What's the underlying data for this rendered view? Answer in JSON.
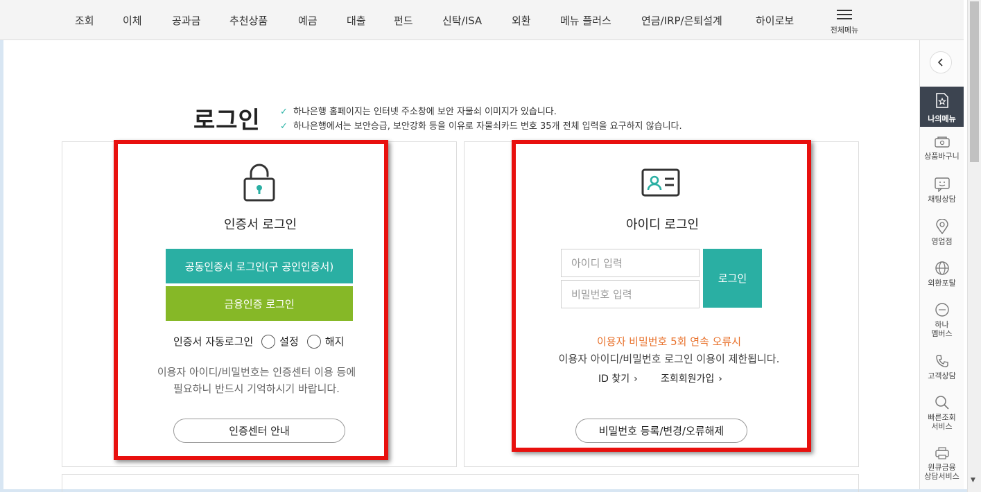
{
  "nav": {
    "items": [
      "조회",
      "이체",
      "공과금",
      "추천상품",
      "예금",
      "대출",
      "펀드",
      "신탁/ISA",
      "외환",
      "메뉴 플러스",
      "연금/IRP/은퇴설계",
      "하이로보"
    ],
    "all_menu_label": "전체메뉴",
    "all_menu_icon": "hamburger-icon"
  },
  "title": "로그인",
  "notices": [
    "하나은행 홈페이지는 인터넷 주소창에 보안 자물쇠 이미지가 있습니다.",
    "하나은행에서는 보안승급, 보안강화 등을 이유로 자물쇠카드 번호 35개 전체 입력을 요구하지 않습니다."
  ],
  "cert_login": {
    "icon": "lock-icon",
    "heading": "인증서 로그인",
    "joint_cert_button": "공동인증서 로그인(구 공인인증서)",
    "financial_cert_button": "금융인증 로그인",
    "auto_login_label": "인증서 자동로그인",
    "option_set": "설정",
    "option_unset": "해지",
    "note_line1": "이용자 아이디/비밀번호는 인증센터 이용 등에",
    "note_line2": "필요하니 반드시 기억하시기 바랍니다.",
    "cert_center_button": "인증센터 안내"
  },
  "id_login": {
    "icon": "id-card-icon",
    "heading": "아이디 로그인",
    "id_placeholder": "아이디 입력",
    "pw_placeholder": "비밀번호 입력",
    "login_button": "로그인",
    "warning_orange": "이용자 비밀번호 5회 연속 오류시",
    "warning_gray": "이용자 아이디/비밀번호 로그인 이용이 제한됩니다.",
    "find_id": "ID 찾기",
    "join": "조회회원가입",
    "pw_button": "비밀번호 등록/변경/오류해제"
  },
  "quickbar": {
    "my_menu": "나의메뉴",
    "items": [
      {
        "label": "상품바구니",
        "icon": "basket-icon"
      },
      {
        "label": "채팅상담",
        "icon": "chat-icon"
      },
      {
        "label": "영업점",
        "icon": "location-pin-icon"
      },
      {
        "label": "외환포탈",
        "icon": "globe-icon"
      },
      {
        "label": "하나",
        "label2": "멤버스",
        "icon": "hana-members-icon"
      },
      {
        "label": "고객상담",
        "icon": "phone-icon"
      },
      {
        "label": "빠른조회",
        "label2": "서비스",
        "icon": "search-icon"
      },
      {
        "label": "원큐금융",
        "label2": "상담서비스",
        "icon": "print-icon"
      }
    ]
  },
  "colors": {
    "teal": "#2aafa3",
    "green": "#86b827",
    "orange": "#e8712b",
    "highlight_red": "#e8100e",
    "dark_sidebar": "#3c4450"
  }
}
